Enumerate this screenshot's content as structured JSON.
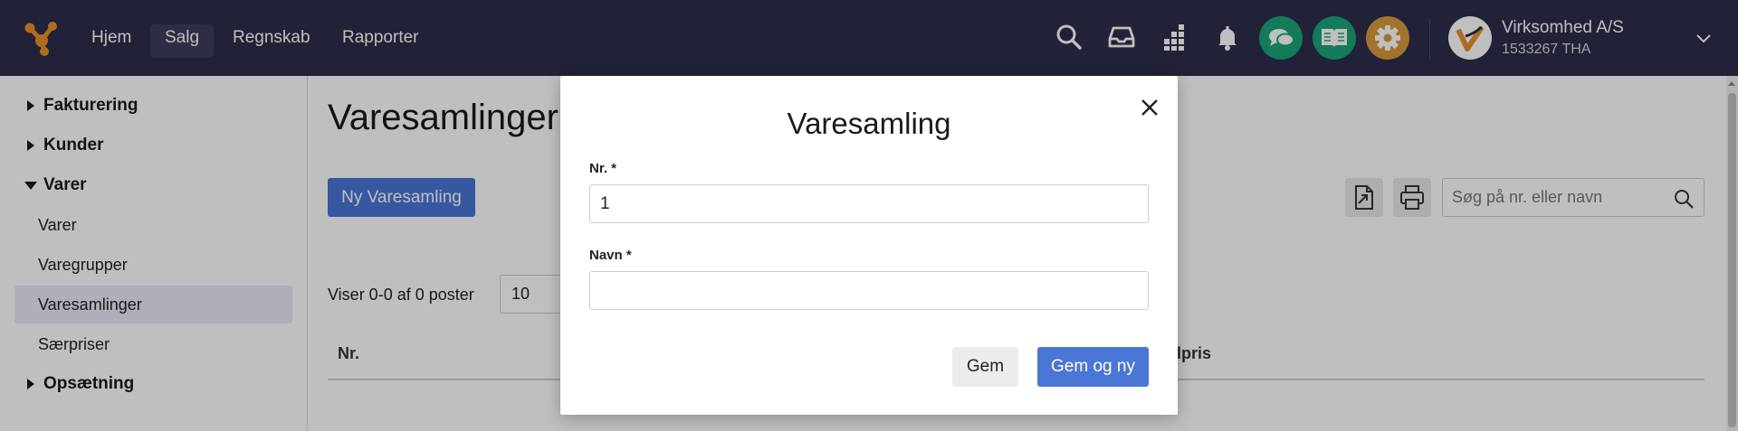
{
  "colors": {
    "topbar": "#2c2c4a",
    "primary": "#4a76d6",
    "chat_green": "#1aa37a",
    "book_green": "#1aa37a",
    "gear_orange": "#d99a3c",
    "logo_orange": "#e8902a"
  },
  "topnav": {
    "items": [
      {
        "label": "Hjem",
        "active": false
      },
      {
        "label": "Salg",
        "active": true
      },
      {
        "label": "Regnskab",
        "active": false
      },
      {
        "label": "Rapporter",
        "active": false
      }
    ],
    "icons": [
      "search-icon",
      "inbox-icon",
      "apps-grid-icon",
      "bell-icon",
      "chat-icon",
      "book-icon",
      "gear-icon"
    ],
    "company": {
      "name": "Virksomhed A/S",
      "id": "1533267 THA"
    }
  },
  "sidebar": {
    "items": [
      {
        "label": "Fakturering",
        "type": "section",
        "expanded": false
      },
      {
        "label": "Kunder",
        "type": "section",
        "expanded": false
      },
      {
        "label": "Varer",
        "type": "section",
        "expanded": true
      },
      {
        "label": "Varer",
        "type": "sub"
      },
      {
        "label": "Varegrupper",
        "type": "sub"
      },
      {
        "label": "Varesamlinger",
        "type": "sub",
        "active": true
      },
      {
        "label": "Særpriser",
        "type": "sub"
      },
      {
        "label": "Opsætning",
        "type": "section",
        "expanded": false
      }
    ]
  },
  "main": {
    "title": "Varesamlinger",
    "new_button": "Ny Varesamling",
    "search_placeholder": "Søg på nr. eller navn",
    "showing": "Viser 0-0 af 0 poster",
    "page_size": "10",
    "columns": [
      "Nr.",
      "lpris"
    ]
  },
  "modal": {
    "title": "Varesamling",
    "fields": [
      {
        "label": "Nr. *",
        "value": "1"
      },
      {
        "label": "Navn *",
        "value": ""
      }
    ],
    "save_label": "Gem",
    "save_new_label": "Gem og ny"
  }
}
